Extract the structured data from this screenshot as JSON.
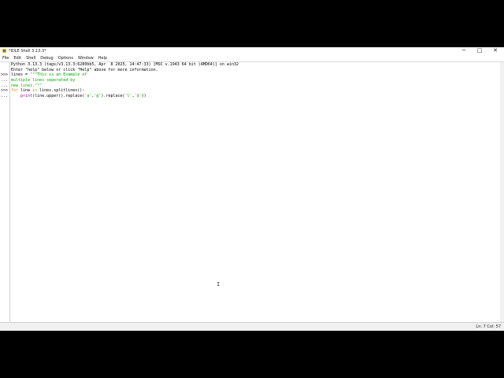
{
  "window": {
    "title": "*IDLE Shell 3.13.3*",
    "controls": {
      "minimize": "─",
      "maximize": "□",
      "close": "✕"
    }
  },
  "menu": [
    "File",
    "Edit",
    "Shell",
    "Debug",
    "Options",
    "Window",
    "Help"
  ],
  "gutter": [
    "",
    "",
    ">>>",
    "...",
    "...",
    ">>>",
    "..."
  ],
  "shell": {
    "banner1": "Python 3.13.3 (tags/v3.13.3:6280bb5, Apr  8 2025, 14:47:33) [MSC v.1943 64 bit (AMD64)] on win32",
    "banner2": "Enter \"help\" below or click \"Help\" above for more information.",
    "line3_a": "lines = ",
    "line3_b": "\"\"\"This is an Example of",
    "line4": "multiple lines seperated by",
    "line5": "new lines.\"\"\"",
    "line6_kw1": "for",
    "line6_b": " line ",
    "line6_kw2": "in",
    "line6_c": " lines.splitlines():",
    "line7_a": "    ",
    "line7_fn": "print",
    "line7_b": "(line.upper().replace(",
    "line7_s1": "'a'",
    "line7_c": ",",
    "line7_s2": "'@'",
    "line7_d": ").replace(",
    "line7_s3": "'l'",
    "line7_e": ",",
    "line7_s4": "'$'",
    "line7_f": "))"
  },
  "status": {
    "position": "Ln: 7   Col: 57"
  },
  "colors": {
    "keyword": "#ff7700",
    "string": "#00aa00",
    "builtin": "#900090"
  },
  "icons": {
    "app": "idle-python-icon",
    "cursor": "text-cursor-icon"
  }
}
